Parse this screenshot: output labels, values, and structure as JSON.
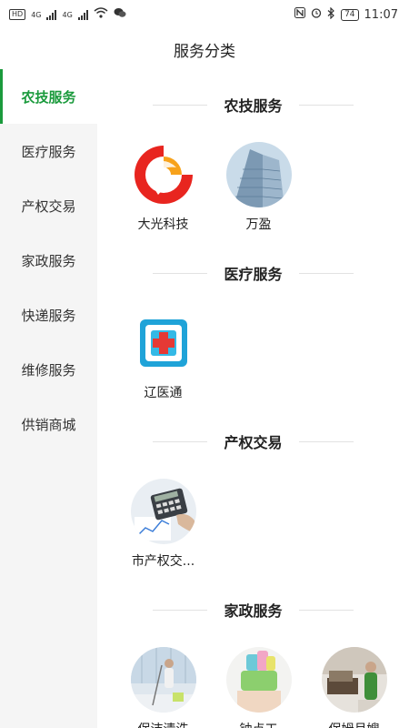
{
  "status_bar": {
    "left_tags": [
      "HD",
      "4G",
      "4G"
    ],
    "battery": "74",
    "time": "11:07"
  },
  "header": {
    "title": "服务分类"
  },
  "sidebar": {
    "items": [
      {
        "label": "农技服务",
        "active": true
      },
      {
        "label": "医疗服务",
        "active": false
      },
      {
        "label": "产权交易",
        "active": false
      },
      {
        "label": "家政服务",
        "active": false
      },
      {
        "label": "快递服务",
        "active": false
      },
      {
        "label": "维修服务",
        "active": false
      },
      {
        "label": "供销商城",
        "active": false
      }
    ]
  },
  "sections": [
    {
      "title": "农技服务",
      "items": [
        {
          "label": "大光科技",
          "icon": "dasun-logo-icon"
        },
        {
          "label": "万盈",
          "icon": "skyscraper-photo-icon"
        }
      ]
    },
    {
      "title": "医疗服务",
      "items": [
        {
          "label": "辽医通",
          "icon": "medical-cross-logo-icon"
        }
      ]
    },
    {
      "title": "产权交易",
      "items": [
        {
          "label": "市产权交...",
          "icon": "calculator-photo-icon"
        }
      ]
    },
    {
      "title": "家政服务",
      "items": [
        {
          "label": "保洁清洗",
          "icon": "cleaning-photo-icon"
        },
        {
          "label": "钟点工",
          "icon": "hourly-worker-photo-icon"
        },
        {
          "label": "保姆月嫂",
          "icon": "nanny-photo-icon"
        }
      ]
    }
  ],
  "colors": {
    "accent": "#1a9a3c",
    "sidebar_bg": "#f5f5f5"
  }
}
